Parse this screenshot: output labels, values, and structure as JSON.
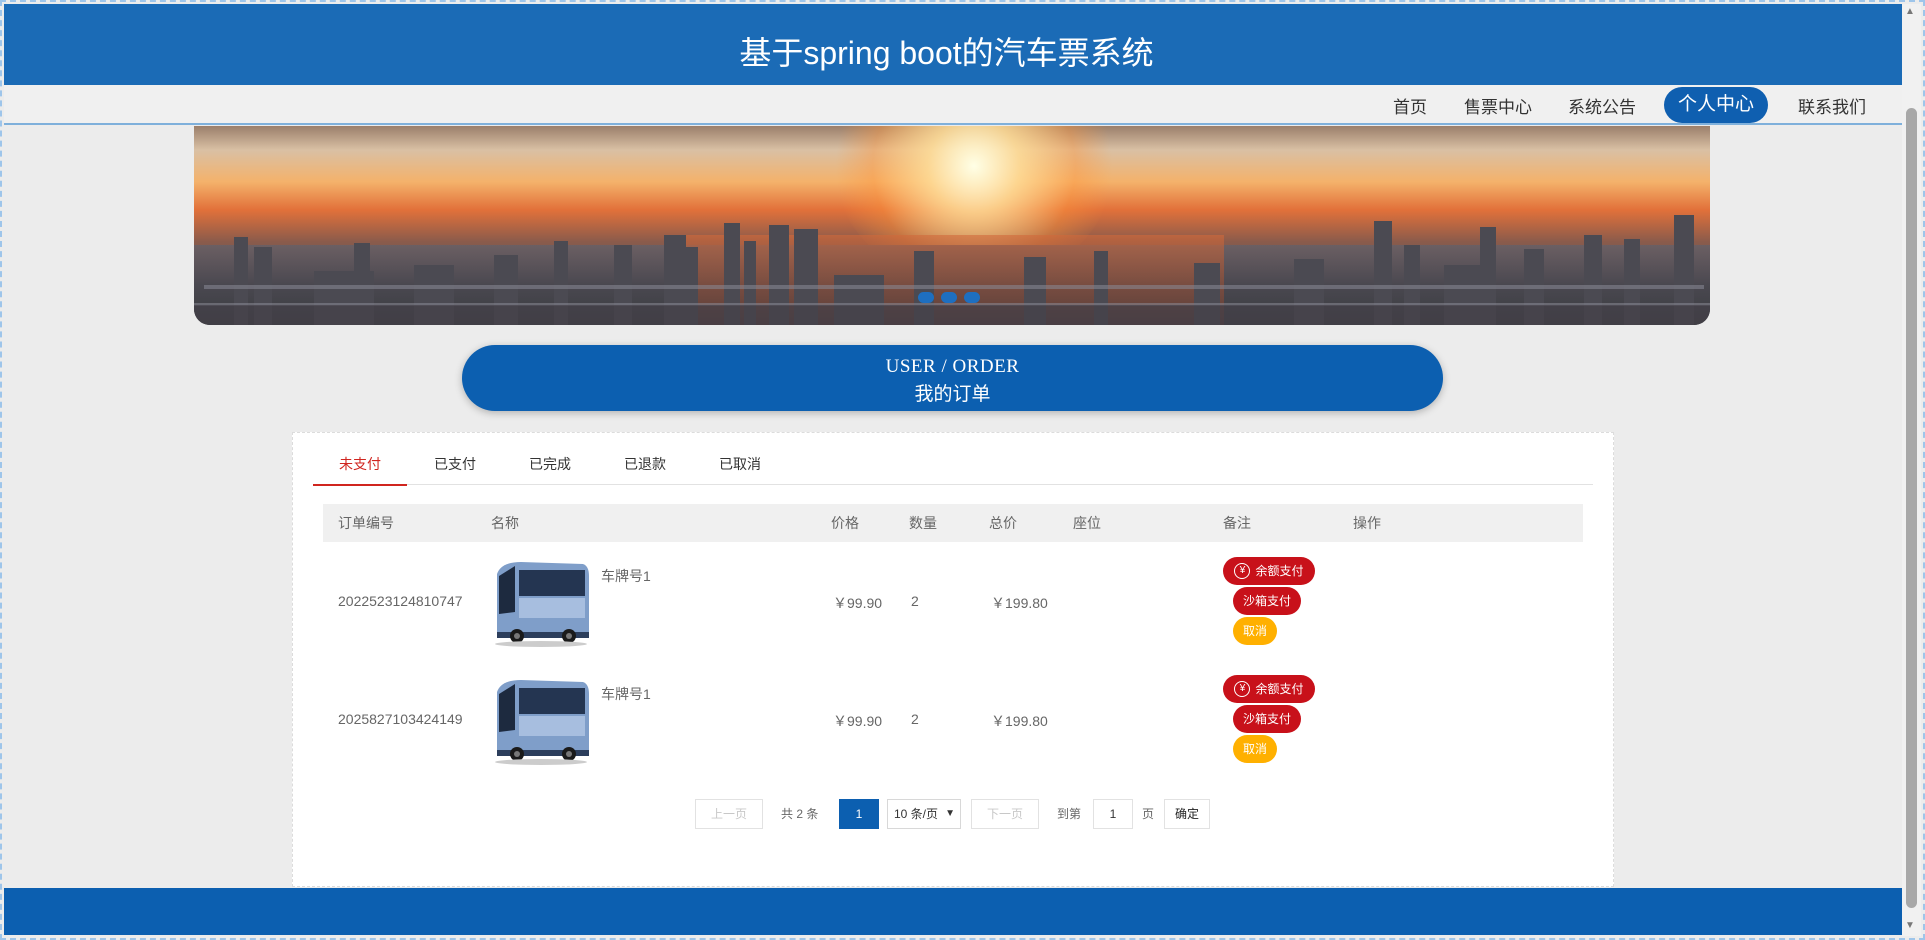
{
  "header": {
    "title": "基于spring boot的汽车票系统"
  },
  "nav": {
    "items": [
      {
        "label": "首页"
      },
      {
        "label": "售票中心"
      },
      {
        "label": "系统公告"
      },
      {
        "label": "个人中心"
      },
      {
        "label": "联系我们"
      }
    ],
    "active": "个人中心"
  },
  "section": {
    "title_en": "USER / ORDER",
    "title_cn": "我的订单"
  },
  "tabs": [
    {
      "label": "未支付"
    },
    {
      "label": "已支付"
    },
    {
      "label": "已完成"
    },
    {
      "label": "已退款"
    },
    {
      "label": "已取消"
    }
  ],
  "table": {
    "headers": [
      "订单编号",
      "名称",
      "价格",
      "数量",
      "总价",
      "座位",
      "备注",
      "操作"
    ],
    "rows": [
      {
        "order_no": "2022523124810747",
        "name": "车牌号1",
        "price": "￥99.90",
        "qty": "2",
        "total": "￥199.80",
        "seat": "",
        "remark": "",
        "actions": [
          "余额支付",
          "沙箱支付",
          "取消"
        ]
      },
      {
        "order_no": "2025827103424149",
        "name": "车牌号1",
        "price": "￥99.90",
        "qty": "2",
        "total": "￥199.80",
        "seat": "",
        "remark": "",
        "actions": [
          "余额支付",
          "沙箱支付",
          "取消"
        ]
      }
    ]
  },
  "pager": {
    "prev": "上一页",
    "total": "共 2 条",
    "current": "1",
    "page_size": "10 条/页",
    "next": "下一页",
    "goto": "到第",
    "goto_value": "1",
    "page_unit": "页",
    "confirm": "确定"
  },
  "colors": {
    "primary": "#0c5fb0",
    "header": "#1b6bb6",
    "danger": "#c8111a",
    "warning": "#ffb000",
    "active_tab": "#d0251f"
  }
}
